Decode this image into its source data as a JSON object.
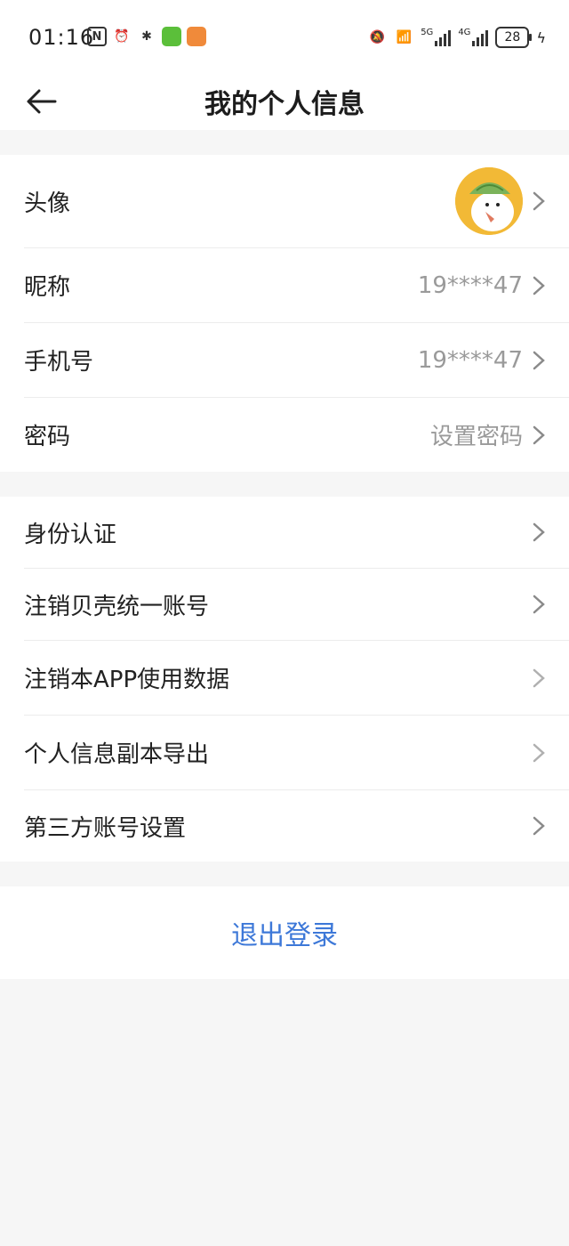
{
  "status_bar": {
    "time": "01:16",
    "battery": "28",
    "network_1": "5G",
    "network_2": "4G"
  },
  "header": {
    "title": "我的个人信息"
  },
  "profile": {
    "avatar_label": "头像",
    "nickname_label": "昵称",
    "nickname_value": "19****47",
    "phone_label": "手机号",
    "phone_value": "19****47",
    "password_label": "密码",
    "password_value": "设置密码"
  },
  "account": {
    "items": [
      {
        "label": "身份认证"
      },
      {
        "label": "注销贝壳统一账号"
      },
      {
        "label": "注销本APP使用数据"
      },
      {
        "label": "个人信息副本导出"
      },
      {
        "label": "第三方账号设置"
      }
    ]
  },
  "logout": {
    "label": "退出登录"
  },
  "colors": {
    "accent": "#3d78d8",
    "muted_text": "#9a9a9a",
    "background": "#f6f6f6"
  }
}
